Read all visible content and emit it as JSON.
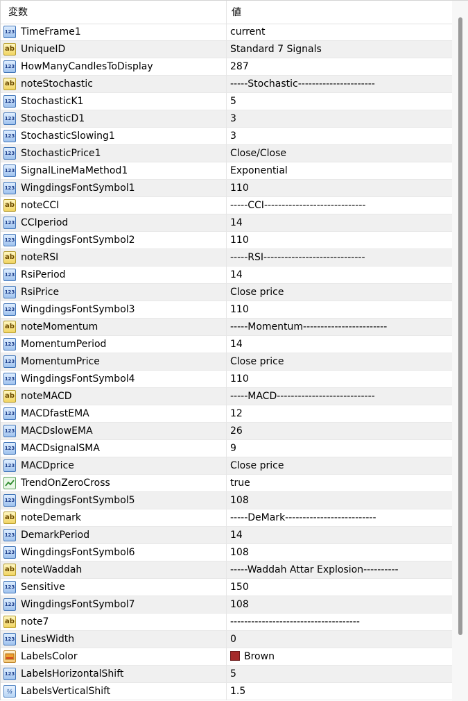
{
  "header": {
    "col_name": "変数",
    "col_value": "値"
  },
  "rows": [
    {
      "icon": "int",
      "name": "TimeFrame1",
      "value": "current"
    },
    {
      "icon": "str",
      "name": "UniqueID",
      "value": "Standard 7 Signals"
    },
    {
      "icon": "int",
      "name": "HowManyCandlesToDisplay",
      "value": "287"
    },
    {
      "icon": "str",
      "name": "noteStochastic",
      "value": "-----Stochastic----------------------"
    },
    {
      "icon": "int",
      "name": "StochasticK1",
      "value": "5"
    },
    {
      "icon": "int",
      "name": "StochasticD1",
      "value": "3"
    },
    {
      "icon": "int",
      "name": "StochasticSlowing1",
      "value": "3"
    },
    {
      "icon": "int",
      "name": "StochasticPrice1",
      "value": "Close/Close"
    },
    {
      "icon": "int",
      "name": "SignalLineMaMethod1",
      "value": "Exponential"
    },
    {
      "icon": "int",
      "name": "WingdingsFontSymbol1",
      "value": "110"
    },
    {
      "icon": "str",
      "name": "noteCCI",
      "value": "-----CCI-----------------------------"
    },
    {
      "icon": "int",
      "name": "CCIperiod",
      "value": "14"
    },
    {
      "icon": "int",
      "name": "WingdingsFontSymbol2",
      "value": "110"
    },
    {
      "icon": "str",
      "name": "noteRSI",
      "value": "-----RSI-----------------------------"
    },
    {
      "icon": "int",
      "name": "RsiPeriod",
      "value": "14"
    },
    {
      "icon": "int",
      "name": "RsiPrice",
      "value": "Close price"
    },
    {
      "icon": "int",
      "name": "WingdingsFontSymbol3",
      "value": "110"
    },
    {
      "icon": "str",
      "name": "noteMomentum",
      "value": "-----Momentum------------------------"
    },
    {
      "icon": "int",
      "name": "MomentumPeriod",
      "value": "14"
    },
    {
      "icon": "int",
      "name": "MomentumPrice",
      "value": "Close price"
    },
    {
      "icon": "int",
      "name": "WingdingsFontSymbol4",
      "value": "110"
    },
    {
      "icon": "str",
      "name": "noteMACD",
      "value": "-----MACD----------------------------"
    },
    {
      "icon": "int",
      "name": "MACDfastEMA",
      "value": "12"
    },
    {
      "icon": "int",
      "name": "MACDslowEMA",
      "value": "26"
    },
    {
      "icon": "int",
      "name": "MACDsignalSMA",
      "value": "9"
    },
    {
      "icon": "int",
      "name": "MACDprice",
      "value": "Close price"
    },
    {
      "icon": "bool",
      "name": "TrendOnZeroCross",
      "value": "true"
    },
    {
      "icon": "int",
      "name": "WingdingsFontSymbol5",
      "value": "108"
    },
    {
      "icon": "str",
      "name": "noteDemark",
      "value": "-----DeMark--------------------------"
    },
    {
      "icon": "int",
      "name": "DemarkPeriod",
      "value": "14"
    },
    {
      "icon": "int",
      "name": "WingdingsFontSymbol6",
      "value": "108"
    },
    {
      "icon": "str",
      "name": "noteWaddah",
      "value": "-----Waddah Attar Explosion----------"
    },
    {
      "icon": "int",
      "name": "Sensitive",
      "value": "150"
    },
    {
      "icon": "int",
      "name": "WingdingsFontSymbol7",
      "value": "108"
    },
    {
      "icon": "str",
      "name": "note7",
      "value": "-------------------------------------"
    },
    {
      "icon": "int",
      "name": "LinesWidth",
      "value": "0"
    },
    {
      "icon": "color",
      "name": "LabelsColor",
      "value": "Brown",
      "swatch": "#a52a2a"
    },
    {
      "icon": "int",
      "name": "LabelsHorizontalShift",
      "value": "5"
    },
    {
      "icon": "dbl",
      "name": "LabelsVerticalShift",
      "value": "1.5"
    }
  ]
}
